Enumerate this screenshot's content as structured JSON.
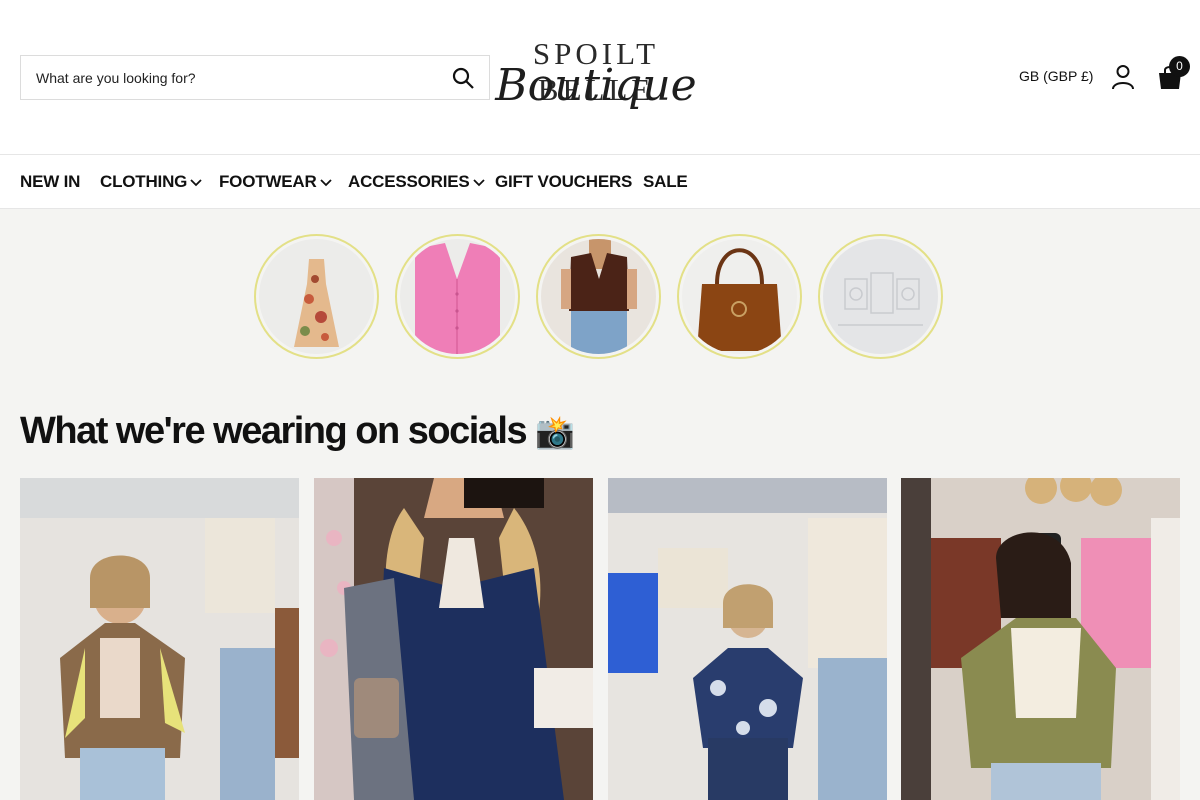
{
  "search": {
    "placeholder": "What are you looking for?"
  },
  "logo": {
    "top": "SPOILT BELLE",
    "script": "Boutique"
  },
  "header": {
    "currency": "GB (GBP £)",
    "bag_count": "0"
  },
  "nav": {
    "items": [
      {
        "label": "NEW IN"
      },
      {
        "label": "CLOTHING"
      },
      {
        "label": "FOOTWEAR"
      },
      {
        "label": "ACCESSORIES"
      },
      {
        "label": "GIFT VOUCHERS"
      },
      {
        "label": "SALE"
      }
    ]
  },
  "category_circles": [
    {
      "icon": "floral-dress-image"
    },
    {
      "icon": "pink-shirt-image"
    },
    {
      "icon": "brown-waistcoat-image"
    },
    {
      "icon": "tan-handbag-image"
    },
    {
      "icon": "gift-voucher-placeholder-image"
    }
  ],
  "socials": {
    "title": "What we're wearing on socials",
    "emoji": "📸"
  },
  "colors": {
    "accent_ring": "#e3e087",
    "text": "#111111",
    "background": "#f4f4f2"
  }
}
